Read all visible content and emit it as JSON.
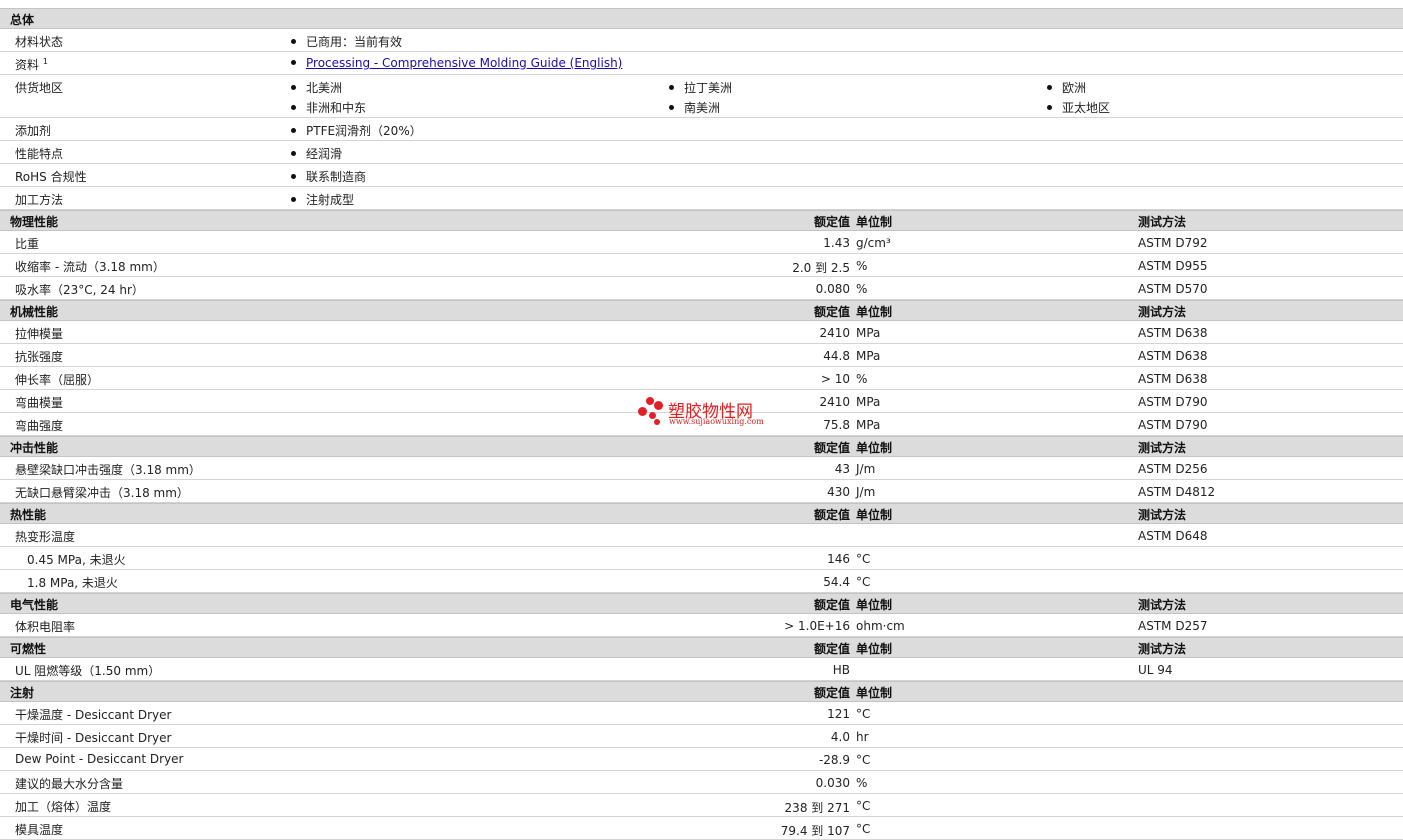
{
  "general": {
    "title": "总体",
    "rows": [
      {
        "label": "材料状态",
        "items": [
          "已商用：当前有效"
        ]
      },
      {
        "label": "资料",
        "sup": "1",
        "link": "Processing - Comprehensive Molding Guide (English)"
      },
      {
        "label": "供货地区",
        "grid": [
          [
            "北美洲",
            "拉丁美洲",
            "欧洲"
          ],
          [
            "非洲和中东",
            "南美洲",
            "亚太地区"
          ]
        ]
      },
      {
        "label": "添加剂",
        "items": [
          "PTFE润滑剂（20%）"
        ]
      },
      {
        "label": "性能特点",
        "items": [
          "经润滑"
        ]
      },
      {
        "label": "RoHS 合规性",
        "items": [
          "联系制造商"
        ]
      },
      {
        "label": "加工方法",
        "items": [
          "注射成型"
        ]
      }
    ]
  },
  "headers": {
    "value": "额定值",
    "unit": "单位制",
    "test": "测试方法"
  },
  "sections": [
    {
      "title": "物理性能",
      "show_test": true,
      "rows": [
        {
          "label": "比重",
          "value": "1.43",
          "unit": "g/cm³",
          "test": "ASTM D792"
        },
        {
          "label": "收缩率 - 流动（3.18 mm）",
          "value": "2.0 到  2.5",
          "unit": "%",
          "test": "ASTM D955"
        },
        {
          "label": "吸水率（23°C, 24 hr）",
          "value": "0.080",
          "unit": "%",
          "test": "ASTM D570"
        }
      ]
    },
    {
      "title": "机械性能",
      "show_test": true,
      "rows": [
        {
          "label": "拉伸模量",
          "value": "2410",
          "unit": "MPa",
          "test": "ASTM D638"
        },
        {
          "label": "抗张强度",
          "value": "44.8",
          "unit": "MPa",
          "test": "ASTM D638"
        },
        {
          "label": "伸长率（屈服）",
          "value": "> 10",
          "unit": "%",
          "test": "ASTM D638"
        },
        {
          "label": "弯曲模量",
          "value": "2410",
          "unit": "MPa",
          "test": "ASTM D790"
        },
        {
          "label": "弯曲强度",
          "value": "75.8",
          "unit": "MPa",
          "test": "ASTM D790"
        }
      ]
    },
    {
      "title": "冲击性能",
      "show_test": true,
      "rows": [
        {
          "label": "悬壁梁缺口冲击强度（3.18 mm）",
          "value": "43",
          "unit": "J/m",
          "test": "ASTM D256"
        },
        {
          "label": "无缺口悬臂梁冲击（3.18 mm）",
          "value": "430",
          "unit": "J/m",
          "test": "ASTM D4812"
        }
      ]
    },
    {
      "title": "热性能",
      "show_test": true,
      "rows": [
        {
          "label": "热变形温度",
          "value": "",
          "unit": "",
          "test": "ASTM D648"
        },
        {
          "label": "0.45 MPa, 未退火",
          "sub": true,
          "value": "146",
          "unit": "°C",
          "test": ""
        },
        {
          "label": "1.8 MPa, 未退火",
          "sub": true,
          "value": "54.4",
          "unit": "°C",
          "test": ""
        }
      ]
    },
    {
      "title": "电气性能",
      "show_test": true,
      "rows": [
        {
          "label": "体积电阻率",
          "value": "> 1.0E+16",
          "unit": "ohm·cm",
          "test": "ASTM D257"
        }
      ]
    },
    {
      "title": "可燃性",
      "show_test": true,
      "rows": [
        {
          "label": "UL 阻燃等级（1.50 mm）",
          "value": "HB",
          "unit": "",
          "test": "UL 94"
        }
      ]
    },
    {
      "title": "注射",
      "show_test": false,
      "rows": [
        {
          "label": "干燥温度 - Desiccant Dryer",
          "value": "121",
          "unit": "°C",
          "test": ""
        },
        {
          "label": "干燥时间 - Desiccant Dryer",
          "value": "4.0",
          "unit": "hr",
          "test": ""
        },
        {
          "label": "Dew Point - Desiccant Dryer",
          "value": "-28.9",
          "unit": "°C",
          "test": ""
        },
        {
          "label": "建议的最大水分含量",
          "value": "0.030",
          "unit": "%",
          "test": ""
        },
        {
          "label": "加工（熔体）温度",
          "value": "238 到  271",
          "unit": "°C",
          "test": ""
        },
        {
          "label": "模具温度",
          "value": "79.4 到  107",
          "unit": "°C",
          "test": ""
        }
      ]
    }
  ],
  "watermark": {
    "name": "塑胶物性网",
    "url": "www.sujiaowuxing.com",
    "color": "#e41e26"
  }
}
